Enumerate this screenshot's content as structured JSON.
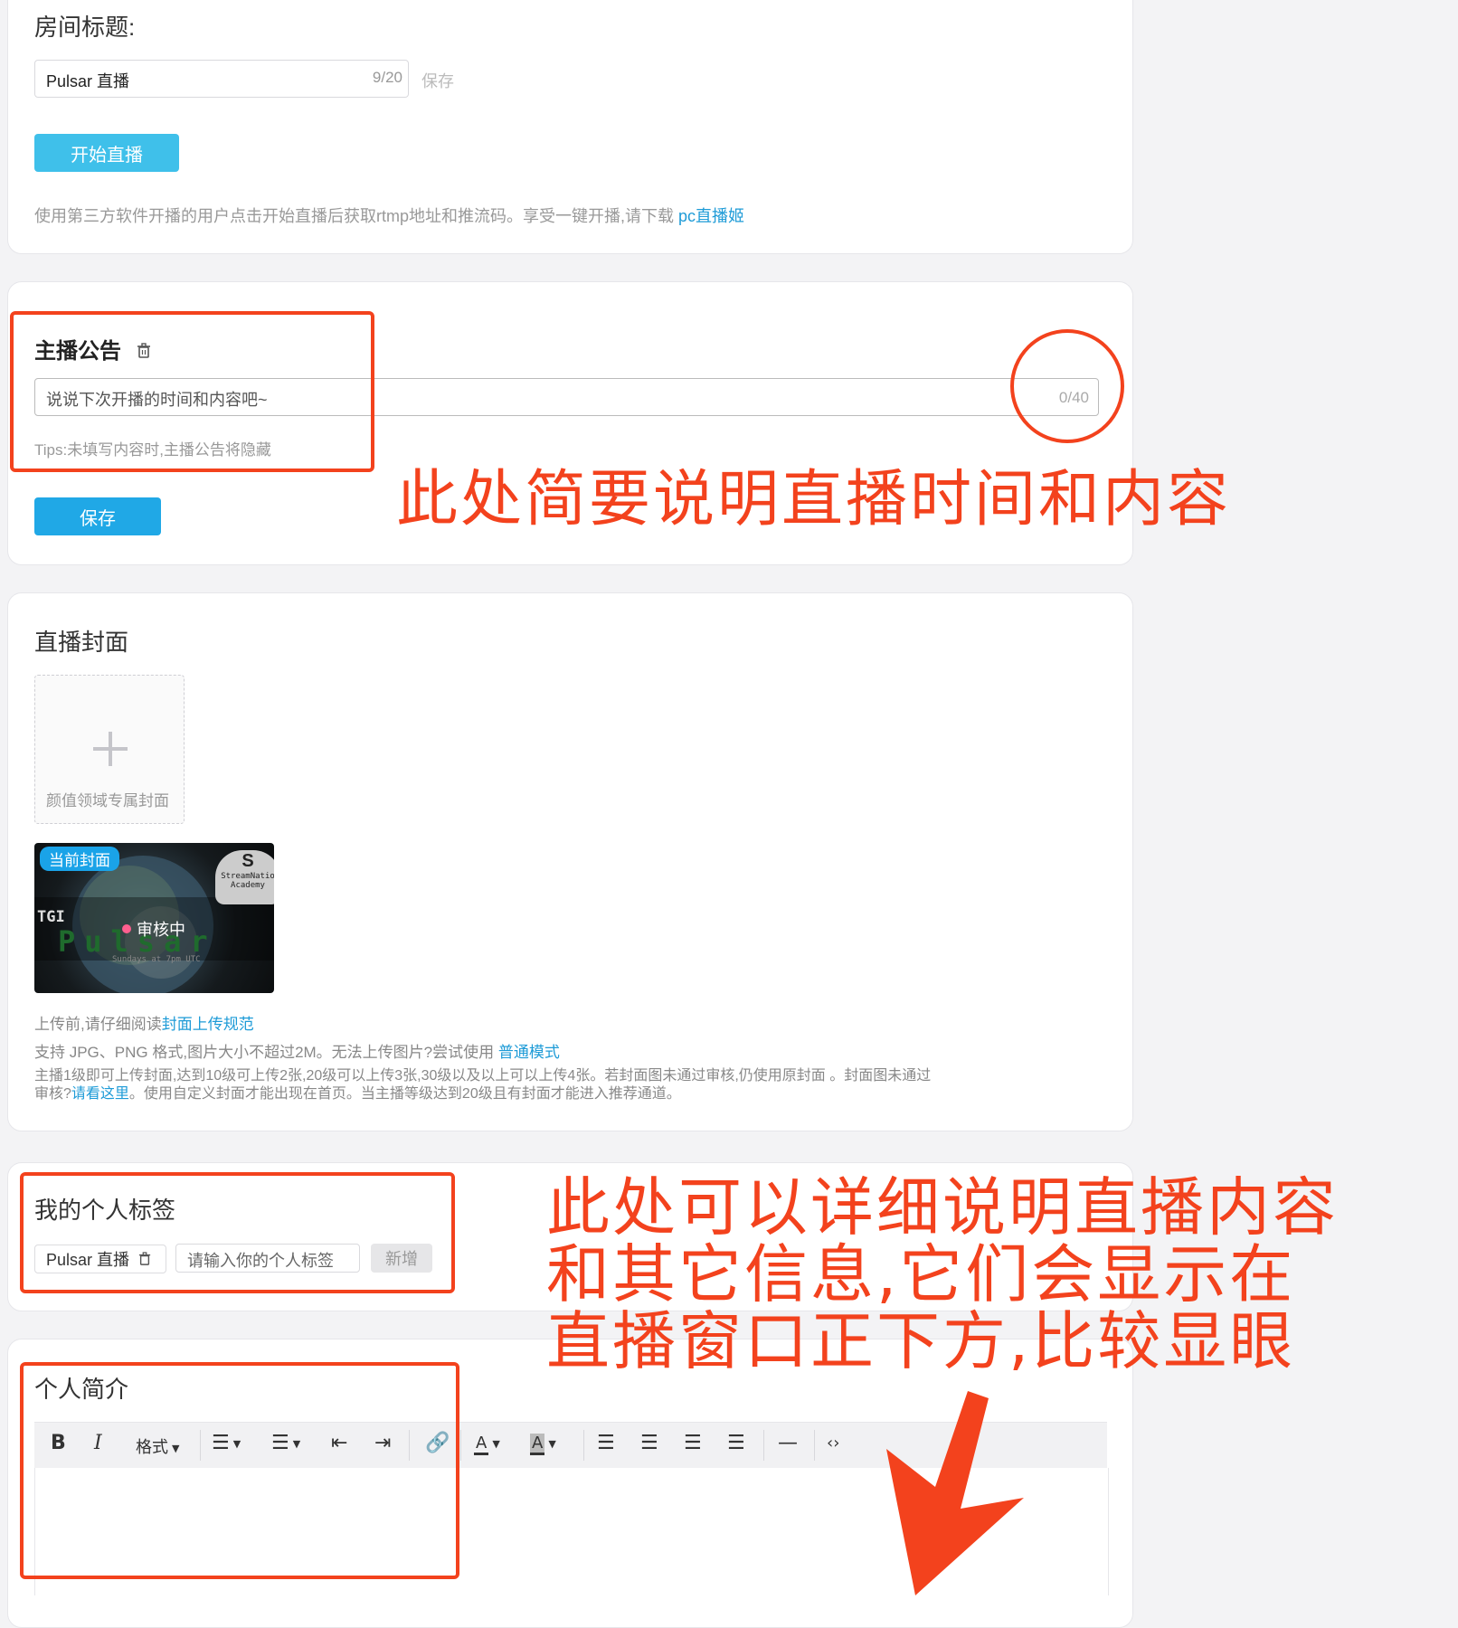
{
  "room": {
    "title_label": "房间标题:",
    "title_value": "Pulsar 直播",
    "title_count": "9/20",
    "save_link": "保存",
    "start_button": "开始直播",
    "hint_text": "使用第三方软件开播的用户点击开始直播后获取rtmp地址和推流码。享受一键开播,请下载 ",
    "hint_link": "pc直播姬"
  },
  "announcement": {
    "heading": "主播公告",
    "placeholder": "说说下次开播的时间和内容吧~",
    "count": "0/40",
    "tips": "Tips:未填写内容时,主播公告将隐藏",
    "save_button": "保存"
  },
  "cover": {
    "heading": "直播封面",
    "upload_label": "颜值领域专属封面",
    "current_badge": "当前封面",
    "review_status": "审核中",
    "thumb_tgi": "TGI",
    "thumb_pulsar": "Pulsar",
    "thumb_sub": "Sundays at 7pm UTC",
    "thumb_logo_1": "StreamNatio",
    "thumb_logo_2": "Academy",
    "info1_text": "上传前,请仔细阅读",
    "info1_link": "封面上传规范",
    "info2_text": "支持 JPG、PNG 格式,图片大小不超过2M。无法上传图片?尝试使用 ",
    "info2_link": "普通模式",
    "info3_text_a": "主播1级即可上传封面,达到10级可上传2张,20级可以上传3张,30级以及以上可以上传4张。若封面图未通过审核,仍使用原封面 。封面图未通过",
    "info3_text_b": "审核?",
    "info3_link": "请看这里",
    "info3_text_c": "。使用自定义封面才能出现在首页。当主播等级达到20级且有封面才能进入推荐通道。"
  },
  "tags": {
    "heading": "我的个人标签",
    "tag_value": "Pulsar 直播",
    "input_placeholder": "请输入你的个人标签",
    "add_button": "新增"
  },
  "bio": {
    "heading": "个人简介",
    "toolbar": {
      "bold": "B",
      "italic": "I",
      "format": "格式",
      "text_color": "A",
      "bg_color": "A"
    }
  },
  "annotations": {
    "note1": "此处简要说明直播时间和内容",
    "note2_line1": "此处可以详细说明直播内容",
    "note2_line2": "和其它信息,它们会显示在",
    "note2_line3": "直播窗口正下方,比较显眼"
  },
  "colors": {
    "annotation_red": "#f3421d",
    "link_blue": "#1e9bd7",
    "button_blue": "#3fc0ea",
    "badge_blue": "#1aa3e8",
    "status_pink": "#ff5f8f"
  },
  "icons": [
    "trash-icon",
    "plus-icon",
    "bullet-list-icon",
    "numbered-list-icon",
    "outdent-icon",
    "indent-icon",
    "link-icon",
    "align-left-icon",
    "align-center-icon",
    "align-right-icon",
    "align-justify-icon",
    "horizontal-rule-icon",
    "code-icon",
    "arrow-icon"
  ]
}
